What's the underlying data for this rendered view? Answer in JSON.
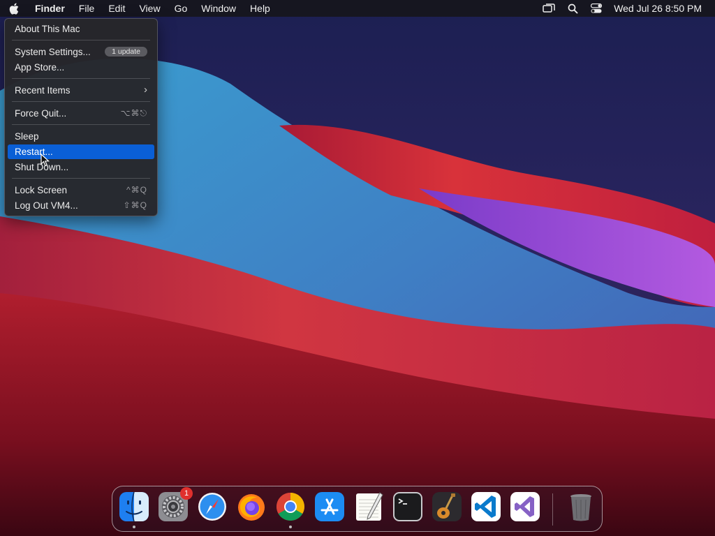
{
  "menubar": {
    "app_name": "Finder",
    "items": [
      "File",
      "Edit",
      "View",
      "Go",
      "Window",
      "Help"
    ],
    "clock": "Wed Jul 26  8:50 PM",
    "status_icons": [
      "screen-mirroring-icon",
      "spotlight-search-icon",
      "control-center-icon"
    ]
  },
  "apple_menu": {
    "about": "About This Mac",
    "system_settings": "System Settings...",
    "system_settings_badge": "1 update",
    "app_store": "App Store...",
    "recent_items": "Recent Items",
    "force_quit": "Force Quit...",
    "force_quit_shortcut": "⌥⌘⎋",
    "sleep": "Sleep",
    "restart": "Restart...",
    "shut_down": "Shut Down...",
    "lock_screen": "Lock Screen",
    "lock_screen_shortcut": "^⌘Q",
    "log_out": "Log Out VM4...",
    "log_out_shortcut": "⇧⌘Q",
    "highlighted_item": "restart"
  },
  "dock": {
    "apps": [
      {
        "name": "Finder",
        "running": true
      },
      {
        "name": "System Settings",
        "badge": "1"
      },
      {
        "name": "Safari"
      },
      {
        "name": "Firefox"
      },
      {
        "name": "Google Chrome",
        "running": true
      },
      {
        "name": "App Store"
      },
      {
        "name": "TextEdit"
      },
      {
        "name": "Terminal"
      },
      {
        "name": "GarageBand"
      },
      {
        "name": "Visual Studio Code"
      },
      {
        "name": "Visual Studio"
      },
      {
        "name": "Trash"
      }
    ]
  },
  "colors": {
    "menu_highlight": "#0a5fd6",
    "badge_red": "#e0302d"
  }
}
